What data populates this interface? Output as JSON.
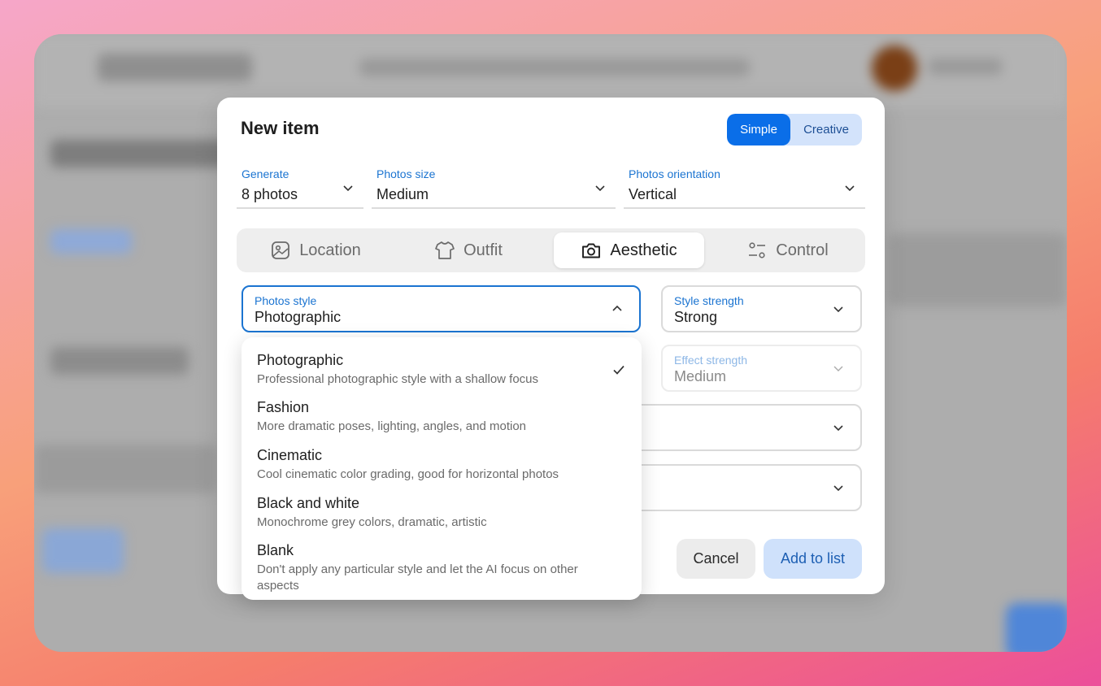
{
  "modal": {
    "title": "New item",
    "mode_toggle": {
      "simple": "Simple",
      "creative": "Creative",
      "selected": "Simple"
    }
  },
  "top_fields": {
    "generate": {
      "label": "Generate",
      "value": "8 photos"
    },
    "photos_size": {
      "label": "Photos size",
      "value": "Medium"
    },
    "photos_orientation": {
      "label": "Photos orientation",
      "value": "Vertical"
    }
  },
  "tabs": [
    {
      "label": "Location",
      "icon": "image-icon",
      "active": false
    },
    {
      "label": "Outfit",
      "icon": "shirt-icon",
      "active": false
    },
    {
      "label": "Aesthetic",
      "icon": "camera-icon",
      "active": true
    },
    {
      "label": "Control",
      "icon": "sliders-icon",
      "active": false
    }
  ],
  "aesthetic": {
    "photos_style": {
      "label": "Photos style",
      "value": "Photographic",
      "open": true
    },
    "style_strength": {
      "label": "Style strength",
      "value": "Strong"
    },
    "effect_strength": {
      "label": "Effect strength",
      "value": "Medium",
      "disabled": true
    }
  },
  "style_options": [
    {
      "title": "Photographic",
      "description": "Professional photographic style with a shallow focus",
      "selected": true
    },
    {
      "title": "Fashion",
      "description": "More dramatic poses, lighting, angles, and motion",
      "selected": false
    },
    {
      "title": "Cinematic",
      "description": "Cool cinematic color grading, good for horizontal photos",
      "selected": false
    },
    {
      "title": "Black and white",
      "description": "Monochrome grey colors, dramatic, artistic",
      "selected": false
    },
    {
      "title": "Blank",
      "description": "Don't apply any particular style and let the AI focus on other aspects",
      "selected": false
    }
  ],
  "actions": {
    "cancel": "Cancel",
    "add": "Add to list"
  },
  "colors": {
    "accent": "#0a6ee8",
    "label_blue": "#1b74d1",
    "add_button_bg": "#cfe1fb"
  }
}
